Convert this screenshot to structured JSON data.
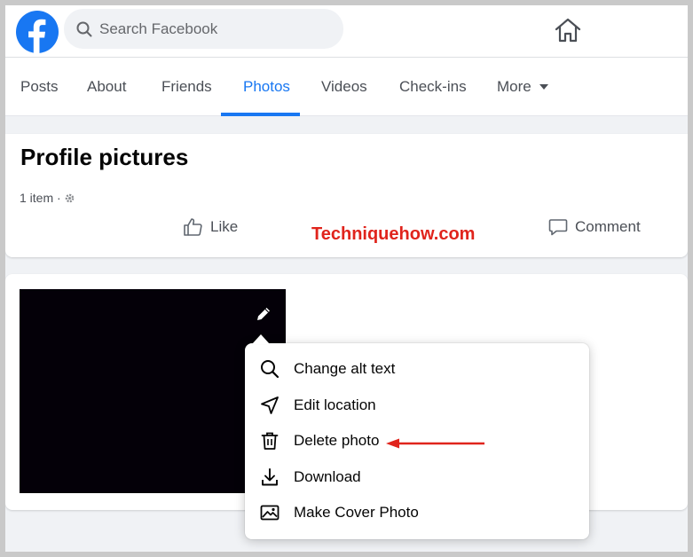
{
  "topbar": {
    "logo_icon": "facebook-logo-icon",
    "search_placeholder": "Search Facebook",
    "search_value": "",
    "home_icon": "home-icon"
  },
  "tabs": [
    {
      "label": "Posts"
    },
    {
      "label": "About"
    },
    {
      "label": "Friends"
    },
    {
      "label": "Photos",
      "active": true
    },
    {
      "label": "Videos"
    },
    {
      "label": "Check-ins"
    },
    {
      "label": "More"
    }
  ],
  "album": {
    "title": "Profile pictures",
    "meta": "1 item ·",
    "like_label": "Like",
    "comment_label": "Comment"
  },
  "watermark": "Techniquehow.com",
  "photo_menu": {
    "items": [
      {
        "label": "Change alt text",
        "icon": "search-icon"
      },
      {
        "label": "Edit location",
        "icon": "location-arrow-icon"
      },
      {
        "label": "Delete photo",
        "icon": "trash-icon"
      },
      {
        "label": "Download",
        "icon": "download-icon"
      },
      {
        "label": "Make Cover Photo",
        "icon": "image-icon"
      }
    ]
  },
  "colors": {
    "accent": "#1877f2",
    "watermark": "#e0241c",
    "arrow": "#e0241c",
    "photo": "#040008"
  }
}
